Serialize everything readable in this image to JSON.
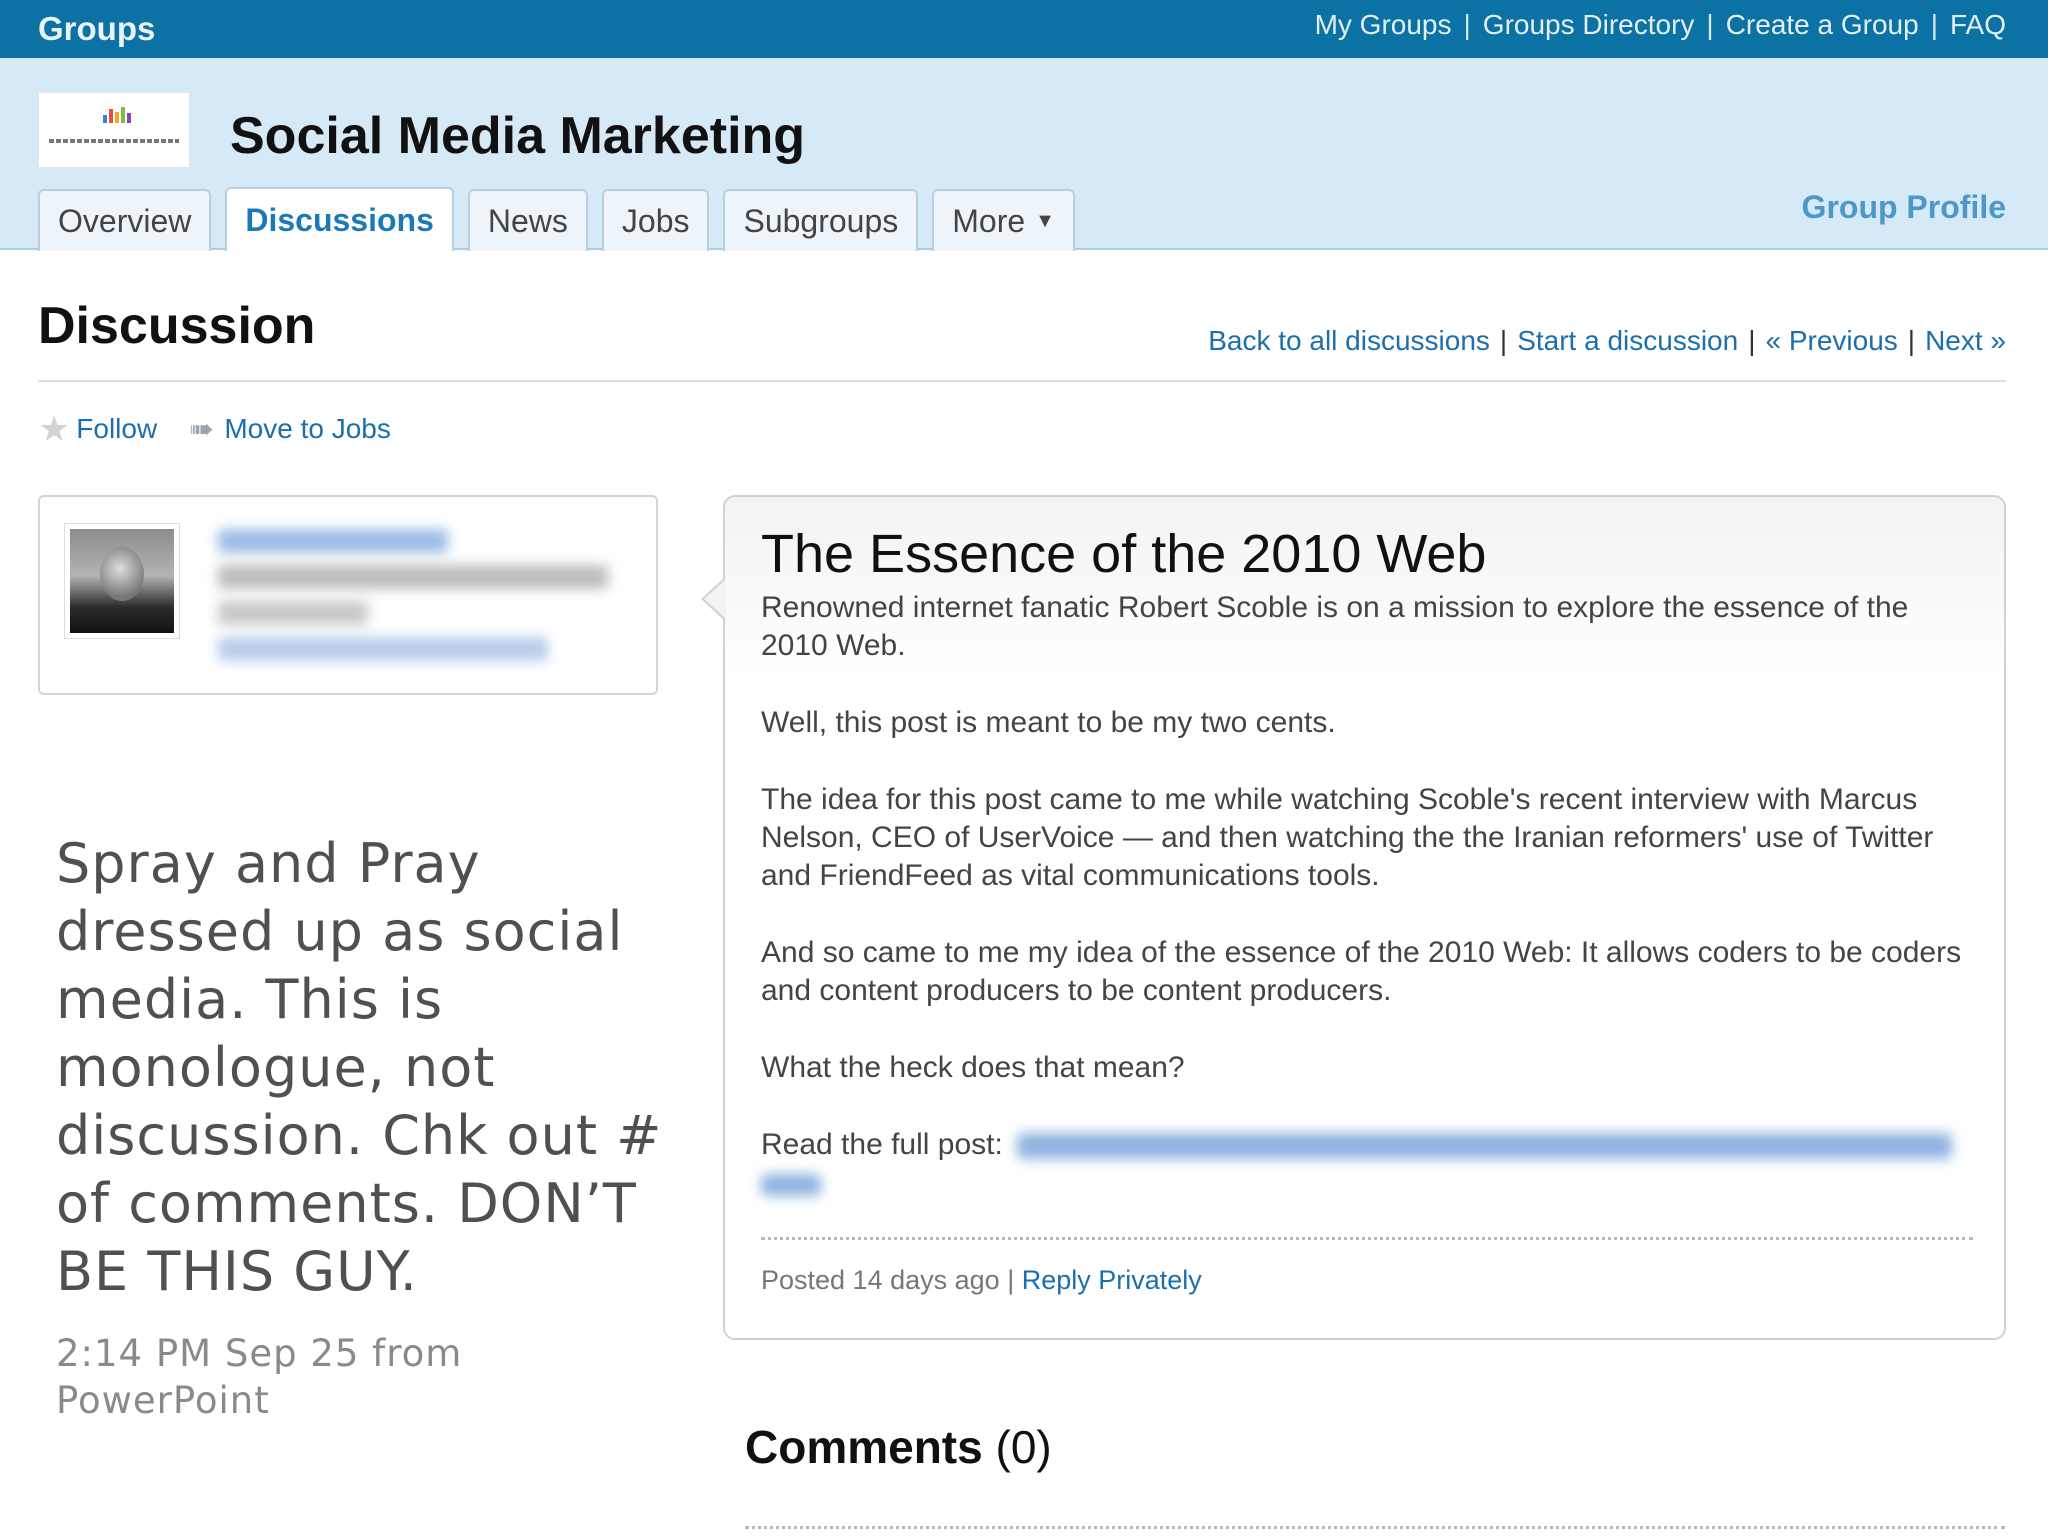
{
  "topbar": {
    "brand": "Groups",
    "links": [
      "My Groups",
      "Groups Directory",
      "Create a Group",
      "FAQ"
    ],
    "background": "#0b72a3"
  },
  "group": {
    "title": "Social Media Marketing",
    "tabs": [
      {
        "label": "Overview",
        "active": false
      },
      {
        "label": "Discussions",
        "active": true
      },
      {
        "label": "News",
        "active": false
      },
      {
        "label": "Jobs",
        "active": false
      },
      {
        "label": "Subgroups",
        "active": false
      },
      {
        "label": "More",
        "active": false
      }
    ],
    "profile_link": "Group Profile",
    "header_background": "#d5e9f6"
  },
  "discussion": {
    "heading": "Discussion",
    "nav": [
      "Back to all discussions",
      "Start a discussion",
      "« Previous",
      "Next »"
    ],
    "actions": {
      "follow": "Follow",
      "move": "Move to Jobs"
    }
  },
  "post": {
    "title": "The Essence of the 2010 Web",
    "paragraphs": [
      "Renowned internet fanatic Robert Scoble is on a mission to explore the essence of the 2010 Web.",
      "Well, this post is meant to be my two cents.",
      "The idea for this post came to me while watching Scoble's recent interview with Marcus Nelson, CEO of UserVoice — and then watching the the Iranian reformers' use of Twitter and FriendFeed as vital communications tools.",
      "And so came to me my idea of the essence of the 2010 Web: It allows coders to be coders and content producers to be content producers.",
      "What the heck does that mean?"
    ],
    "read_full_label": "Read the full post:",
    "posted": "Posted 14 days ago",
    "reply": "Reply Privately"
  },
  "comments": {
    "label": "Comments",
    "count": "(0)"
  },
  "overlay": {
    "text": "Spray and Pray dressed up as social media. This is monologue, not discussion. Chk out # of comments. DON’T BE THIS GUY.",
    "meta": "2:14 PM Sep 25 from PowerPoint"
  },
  "icons": [
    "star-icon",
    "move-icon",
    "caret-down-icon"
  ],
  "colors": {
    "link": "#1c6fae",
    "accent": "#1c79b7"
  }
}
